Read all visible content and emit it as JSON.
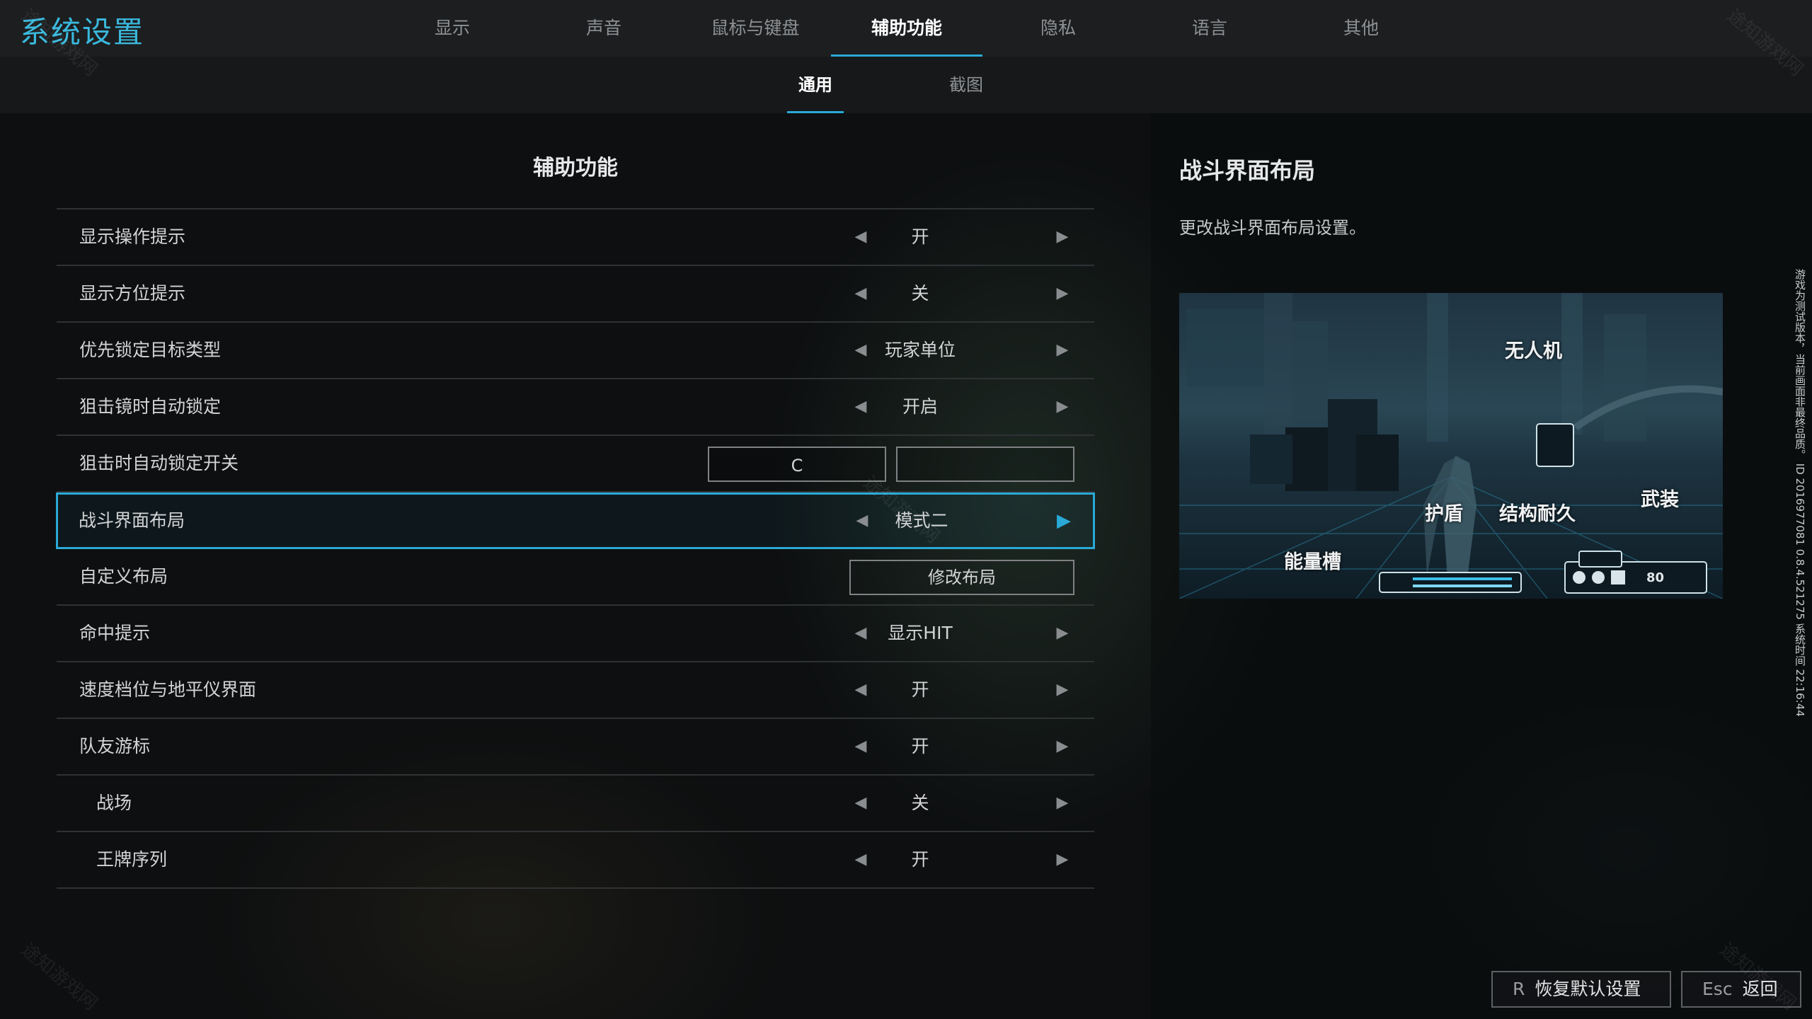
{
  "app_title": "系统设置",
  "main_tabs": [
    {
      "label": "显示"
    },
    {
      "label": "声音"
    },
    {
      "label": "鼠标与键盘"
    },
    {
      "label": "辅助功能"
    },
    {
      "label": "隐私"
    },
    {
      "label": "语言"
    },
    {
      "label": "其他"
    }
  ],
  "active_main_tab": "辅助功能",
  "sub_tabs": [
    {
      "label": "通用"
    },
    {
      "label": "截图"
    }
  ],
  "active_sub_tab": "通用",
  "section_title": "辅助功能",
  "settings": [
    {
      "label": "显示操作提示",
      "value": "开"
    },
    {
      "label": "显示方位提示",
      "value": "关"
    },
    {
      "label": "优先锁定目标类型",
      "value": "玩家单位"
    },
    {
      "label": "狙击镜时自动锁定",
      "value": "开启"
    },
    {
      "label": "狙击时自动锁定开关",
      "key1": "C",
      "key2": ""
    },
    {
      "label": "战斗界面布局",
      "value": "模式二"
    },
    {
      "label": "自定义布局",
      "button": "修改布局"
    },
    {
      "label": "命中提示",
      "value": "显示HIT"
    },
    {
      "label": "速度档位与地平仪界面",
      "value": "开"
    },
    {
      "label": "队友游标",
      "value": "开"
    },
    {
      "label": "战场",
      "value": "关"
    },
    {
      "label": "王牌序列",
      "value": "开"
    }
  ],
  "arrow_left": "◀",
  "arrow_right": "▶",
  "detail": {
    "title": "战斗界面布局",
    "description": "更改战斗界面布局设置。",
    "callouts": {
      "drone": "无人机",
      "shield": "护盾",
      "durability": "结构耐久",
      "armament": "武装",
      "energy": "能量槽"
    },
    "ammo": "80"
  },
  "footer": {
    "reset_key": "R",
    "reset_label": "恢复默认设置",
    "back_key": "Esc",
    "back_label": "返回"
  },
  "side_note": "游戏为测试版本，当前画面非最终品质。 ID 2016977081 0.8.4.521275 系统时间 22:16:44",
  "watermark": "途知游戏网",
  "colors": {
    "accent": "#2aa9d6",
    "title": "#3ab8dc",
    "background": "#0d0f10"
  }
}
